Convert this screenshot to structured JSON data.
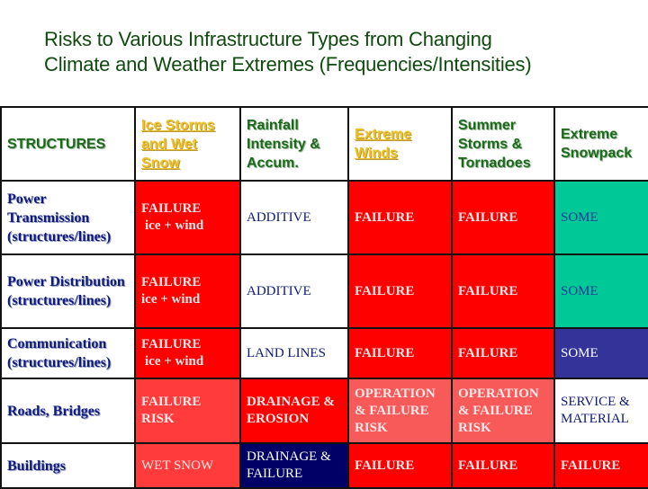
{
  "title_line1": "Risks to Various Infrastructure Types from Changing",
  "title_line2": "Climate and Weather Extremes (Frequencies/Intensities)",
  "colors": {
    "title": "#0f4a0f",
    "header_text": "#1a6a1a",
    "header_link": "#f0c020",
    "row_header_text": "#0d1a7a",
    "failure_red": "#ff0000",
    "risk_light_red": "#ff3b3b",
    "operation_red": "#f85a5a",
    "some_green": "#00c896",
    "some_blue": "#333399",
    "navy": "#000066"
  },
  "table": {
    "headers": [
      {
        "label": "STRUCTURES",
        "link": false
      },
      {
        "label": "Ice Storms and Wet Snow",
        "link": true
      },
      {
        "label": "Rainfall Intensity & Accum.",
        "link": false
      },
      {
        "label": "Extreme Winds",
        "link": true
      },
      {
        "label": "Summer Storms & Tornadoes",
        "link": false
      },
      {
        "label": "Extreme Snowpack",
        "link": false
      }
    ],
    "rows": [
      {
        "structure": "Power Transmission (structures/lines)",
        "cells": [
          {
            "line1": "FAILURE",
            "line2": "ice + wind",
            "color": "red"
          },
          {
            "line1": "ADDITIVE",
            "line2": "",
            "color": "white"
          },
          {
            "line1": "FAILURE",
            "line2": "",
            "color": "red"
          },
          {
            "line1": "FAILURE",
            "line2": "",
            "color": "red"
          },
          {
            "line1": "SOME",
            "line2": "",
            "color": "green"
          }
        ]
      },
      {
        "structure": "Power Distribution (structures/lines)",
        "cells": [
          {
            "line1": "FAILURE",
            "line2": "ice + wind",
            "color": "red"
          },
          {
            "line1": "ADDITIVE",
            "line2": "",
            "color": "white"
          },
          {
            "line1": "FAILURE",
            "line2": "",
            "color": "red"
          },
          {
            "line1": "FAILURE",
            "line2": "",
            "color": "red"
          },
          {
            "line1": "SOME",
            "line2": "",
            "color": "green"
          }
        ]
      },
      {
        "structure": "Communication (structures/lines)",
        "cells": [
          {
            "line1": "FAILURE",
            "line2": "ice + wind",
            "color": "red"
          },
          {
            "line1": "LAND LINES",
            "line2": "",
            "color": "white"
          },
          {
            "line1": "FAILURE",
            "line2": "",
            "color": "red"
          },
          {
            "line1": "FAILURE",
            "line2": "",
            "color": "red"
          },
          {
            "line1": "SOME",
            "line2": "",
            "color": "blue"
          }
        ]
      },
      {
        "structure": "Roads, Bridges",
        "cells": [
          {
            "line1": "FAILURE RISK",
            "line2": "",
            "color": "light-red"
          },
          {
            "line1": "DRAINAGE & EROSION",
            "line2": "",
            "color": "red"
          },
          {
            "line1": "OPERATION & FAILURE RISK",
            "line2": "",
            "color": "operation-red"
          },
          {
            "line1": "OPERATION & FAILURE RISK",
            "line2": "",
            "color": "operation-red"
          },
          {
            "line1": "SERVICE & MATERIAL",
            "line2": "",
            "color": "white"
          }
        ]
      },
      {
        "structure": "Buildings",
        "cells": [
          {
            "line1": "WET SNOW",
            "line2": "",
            "color": "light-red"
          },
          {
            "line1": "DRAINAGE & FAILURE",
            "line2": "",
            "color": "navy"
          },
          {
            "line1": "FAILURE",
            "line2": "",
            "color": "red"
          },
          {
            "line1": "FAILURE",
            "line2": "",
            "color": "red"
          },
          {
            "line1": "FAILURE",
            "line2": "",
            "color": "red"
          }
        ]
      }
    ]
  }
}
